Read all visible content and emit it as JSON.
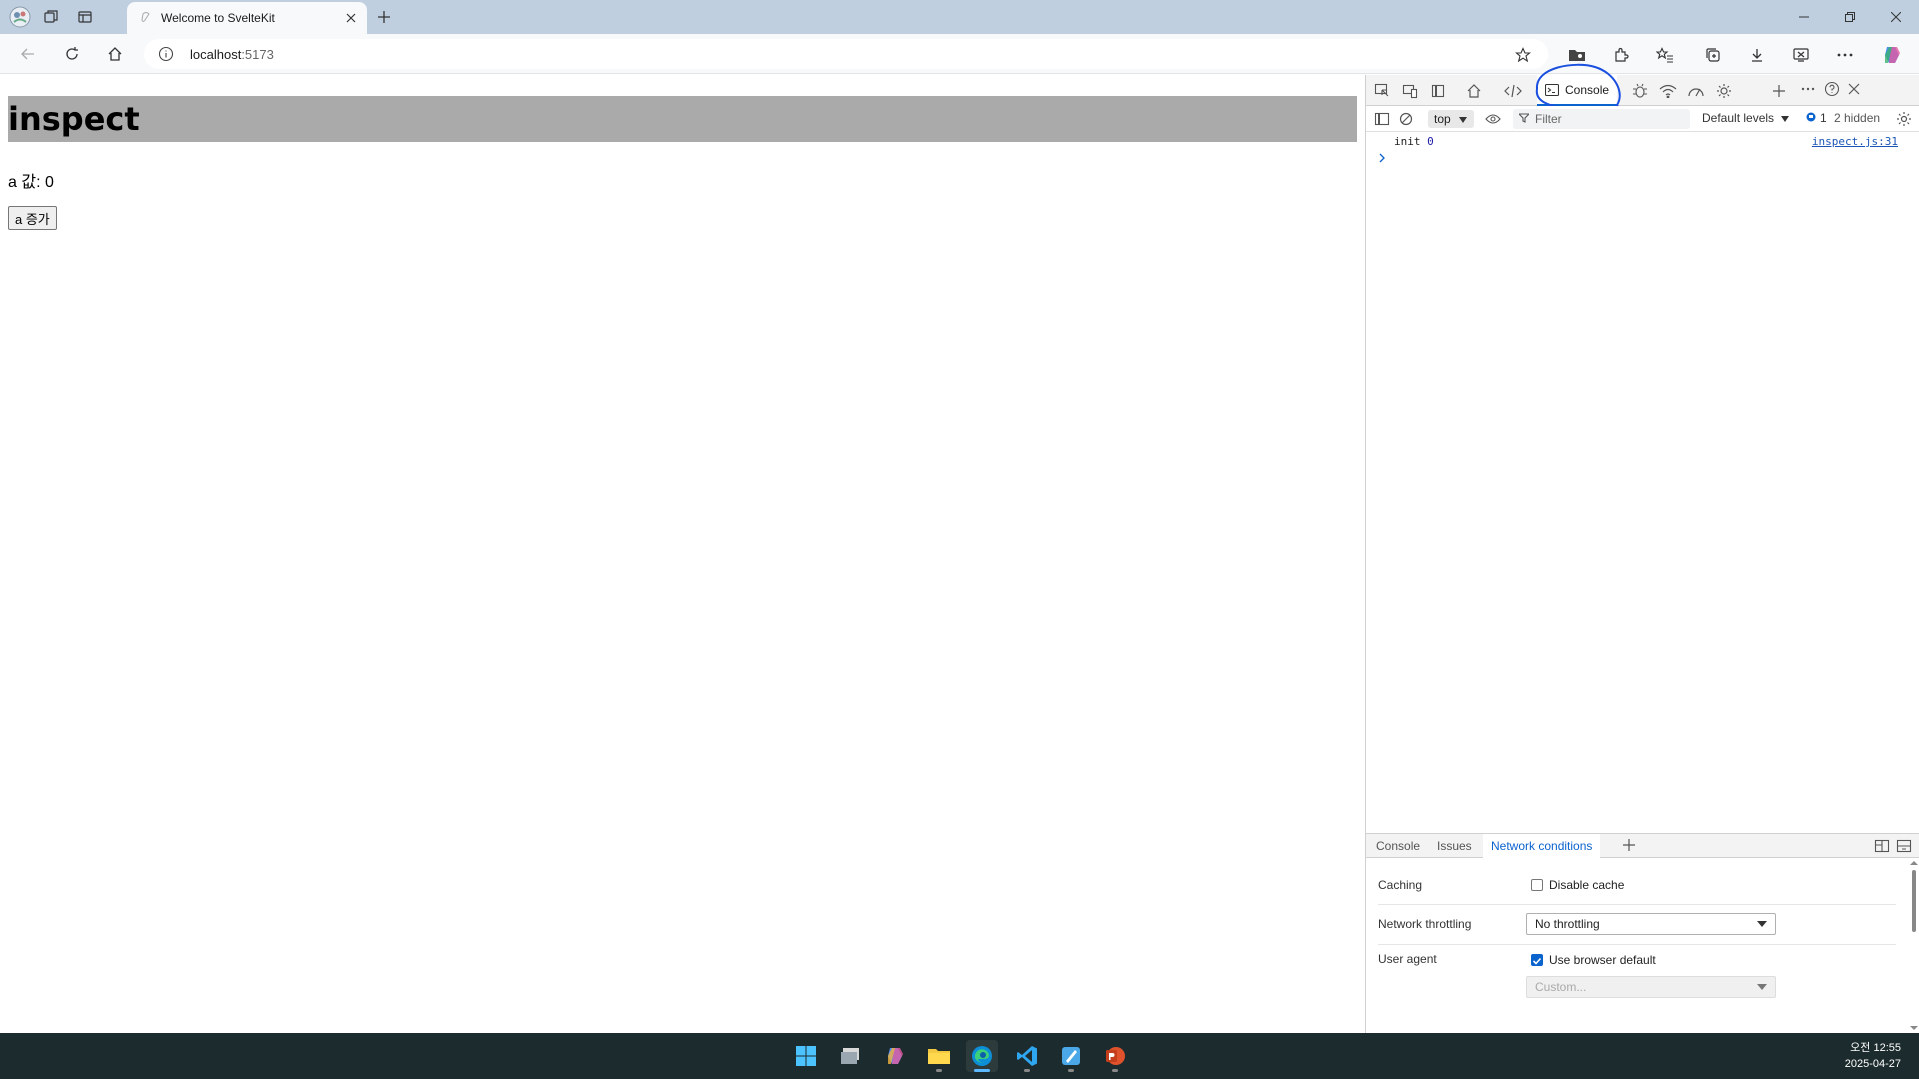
{
  "browser": {
    "tab_title": "Welcome to SvelteKit",
    "url_host": "localhost",
    "url_port": ":5173"
  },
  "page": {
    "heading": "inspect",
    "a_value_text": "a 값: 0",
    "a_button_label": "a 증가"
  },
  "devtools": {
    "active_tab": "Console",
    "context": "top",
    "filter_placeholder": "Filter",
    "levels": "Default levels",
    "issue_count": "1",
    "hidden_count": "2 hidden",
    "log": [
      {
        "text": "init",
        "value": "0",
        "source": "inspect.js:31"
      }
    ],
    "drawer": {
      "tabs": [
        "Console",
        "Issues",
        "Network conditions"
      ],
      "active_tab": "Network conditions",
      "caching_label": "Caching",
      "disable_cache_label": "Disable cache",
      "disable_cache_checked": false,
      "throttling_label": "Network throttling",
      "throttling_value": "No throttling",
      "user_agent_label": "User agent",
      "use_browser_default_label": "Use browser default",
      "use_browser_default_checked": true,
      "custom_placeholder": "Custom..."
    }
  },
  "taskbar": {
    "time": "오전 12:55",
    "date": "2025-04-27",
    "apps": [
      "start-icon",
      "task-view-icon",
      "copilot-icon",
      "file-explorer-icon",
      "edge-icon",
      "vscode-icon",
      "paint-icon",
      "powerpoint-icon"
    ],
    "active_app": "edge-icon"
  },
  "colors": {
    "accent": "#0b63ce",
    "annotation": "#1a4fe0",
    "heading_bg": "#aaaaaa",
    "taskbar_bg": "#1c2b2d",
    "titlebar_bg": "#bfcfe0"
  }
}
